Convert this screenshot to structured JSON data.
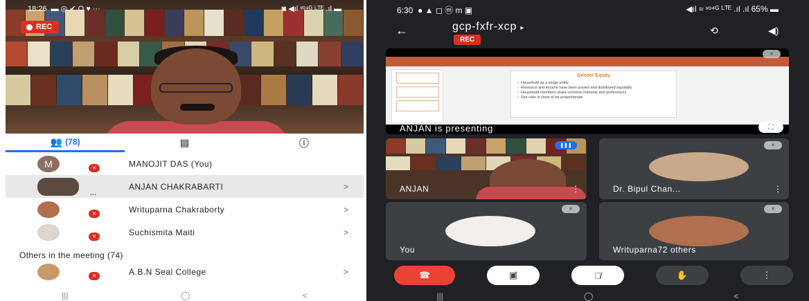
{
  "left": {
    "status_time": "18:26",
    "status_icons_left": "▬ ◎ ✔ Q ♥ ···",
    "status_icons_right": "◙ ◀ıl ᵛᵒ⁴ᴳ ᴸᵀᴱ .ıl ▬",
    "rec_label": "REC",
    "tabs": [
      {
        "label": "(78)",
        "icon": "people-icon"
      },
      {
        "label": "",
        "icon": "chat-icon"
      },
      {
        "label": "",
        "icon": "info-icon"
      }
    ],
    "participants": [
      {
        "name": "MANOJIT DAS (You)",
        "avatar_letter": "M",
        "avatar_color": "#8d6e63",
        "muted": true,
        "chevron": ""
      },
      {
        "name": "ANJAN CHAKRABARTI",
        "avatar_letter": "",
        "avatar_color": "#5a4a40",
        "muted": false,
        "speaking": "...",
        "chevron": ">"
      },
      {
        "name": "Writuparna Chakraborty",
        "avatar_letter": "",
        "avatar_color": "#b07050",
        "muted": true,
        "chevron": ">"
      },
      {
        "name": "Suchismita Maiti",
        "avatar_letter": "",
        "avatar_color": "#e0d6d0",
        "muted": true,
        "chevron": ">"
      }
    ],
    "others_heading": "Others in the meeting (74)",
    "others": [
      {
        "name": "A.B.N Seal College",
        "avatar_color": "#c89a6a",
        "muted": true,
        "chevron": ">"
      }
    ],
    "nav": [
      "|||",
      "◯",
      "<"
    ]
  },
  "right": {
    "status_time": "6:30",
    "status_icons_left": "● ▲ ◻ ⓜ m ▣",
    "status_icons_right": "◀ıl ≈ ᵛᵒ⁴ᴳ ᴸᵀᴱ .ıl .ıl",
    "battery": "65%",
    "meeting_code": "gcp-fxfr-xcp",
    "rec_label": "REC",
    "presentation": {
      "slide_title": "Gender Equity",
      "bullets": [
        "Household as a single entity",
        "Resource and Income have been pooled and distributed equitably",
        "Household members share common interests and preferences",
        "Sex-ratio is close to be proportionate"
      ],
      "presenting_text": "ANJAN is presenting"
    },
    "tiles": [
      {
        "name": "ANJAN",
        "kind": "video"
      },
      {
        "name": "Dr. Bipul Chan...",
        "kind": "avatar"
      },
      {
        "name": "You",
        "kind": "avatar"
      },
      {
        "name": "Writuparna72 others",
        "kind": "avatar"
      }
    ],
    "controls": [
      "end-call",
      "camera-off",
      "mic-off",
      "raise-hand",
      "more"
    ],
    "nav": [
      "|||",
      "◯",
      "<"
    ]
  }
}
